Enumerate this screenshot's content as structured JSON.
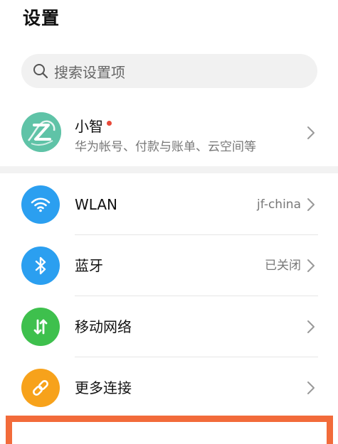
{
  "header": {
    "title": "设置"
  },
  "search": {
    "placeholder": "搜索设置项",
    "icon": "search-icon"
  },
  "account": {
    "name": "小智",
    "subtitle": "华为帐号、付款与账单、云空间等",
    "avatar_color": "#5fc3a7",
    "has_notification_dot": true,
    "dot_color": "#e84a3a"
  },
  "settings": [
    {
      "label": "WLAN",
      "value": "jf-china",
      "icon": "wifi-icon",
      "icon_color": "#2b9ff0"
    },
    {
      "label": "蓝牙",
      "value": "已关闭",
      "icon": "bluetooth-icon",
      "icon_color": "#2b9ff0"
    },
    {
      "label": "移动网络",
      "value": "",
      "icon": "mobile-data-icon",
      "icon_color": "#3ec04d"
    },
    {
      "label": "更多连接",
      "value": "",
      "icon": "link-icon",
      "icon_color": "#f7a21b"
    }
  ],
  "highlight_color": "#f26b3a"
}
